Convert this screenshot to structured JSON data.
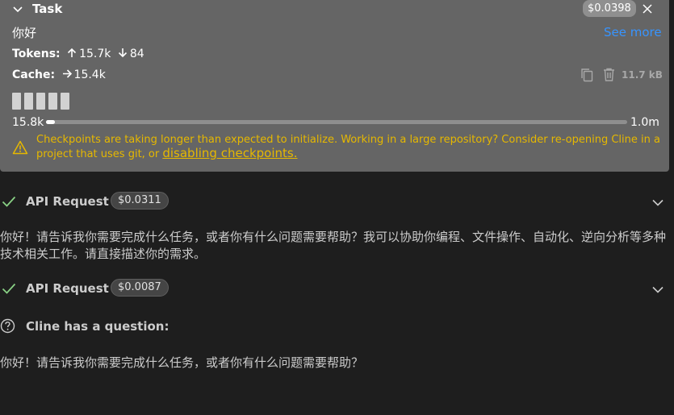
{
  "task": {
    "title": "Task",
    "cost": "$0.0398",
    "text": "你好",
    "see_more": "See more",
    "tokens_label": "Tokens:",
    "tokens_up": "15.7k",
    "tokens_down": "84",
    "cache_label": "Cache:",
    "cache_value": "15.4k",
    "size": "11.7 kB",
    "context_used": "15.8k",
    "context_max": "1.0m",
    "context_fraction": 0.0158,
    "block_count": 5,
    "warning_text": "Checkpoints are taking longer than expected to initialize. Working in a large repository? Consider re-opening Cline in a project that uses git, or ",
    "warning_link": "disabling checkpoints."
  },
  "request1": {
    "title": "API Request",
    "cost": "$0.0311"
  },
  "message1": "你好！请告诉我你需要完成什么任务，或者你有什么问题需要帮助？我可以协助你编程、文件操作、自动化、逆向分析等多种技术相关工作。请直接描述你的需求。",
  "request2": {
    "title": "API Request",
    "cost": "$0.0087"
  },
  "question": {
    "title": "Cline has a question:",
    "text": "你好！请告诉我你需要完成什么任务，或者你有什么问题需要帮助？"
  },
  "colors": {
    "panel_bg": "#656565",
    "warning": "#e6b800",
    "link": "#3794ff",
    "check": "#89d185"
  }
}
